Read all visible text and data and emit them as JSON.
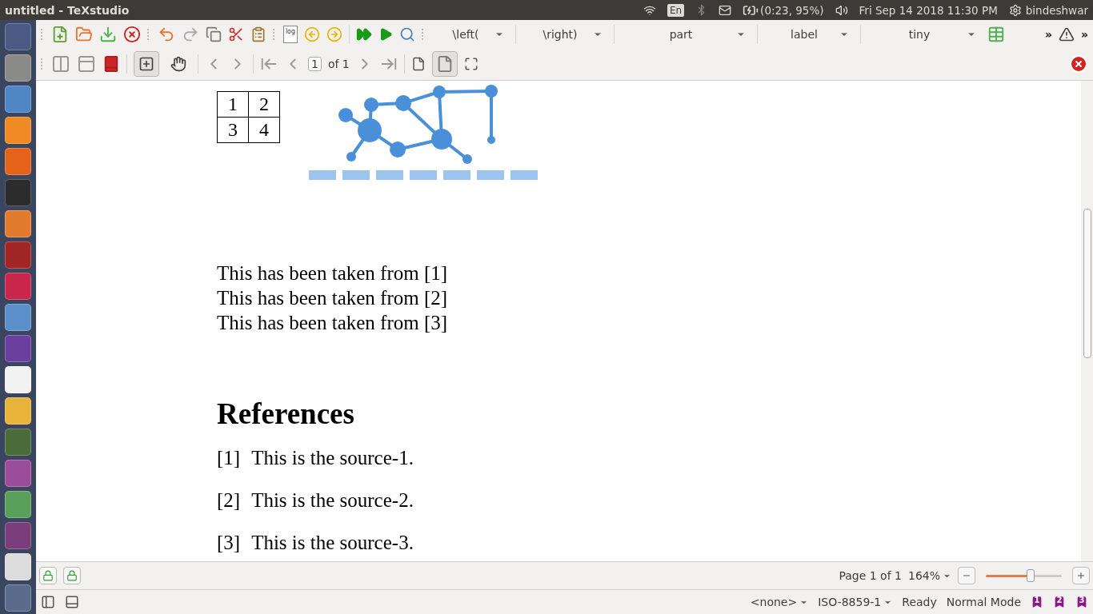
{
  "window": {
    "title": "untitled - TeXstudio"
  },
  "top_panel": {
    "keyboard": "En",
    "battery": "(0:23, 95%)",
    "clock": "Fri Sep 14 2018 11:30 PM",
    "user": "bindeshwar"
  },
  "toolbar": {
    "log_label": "log",
    "combos": [
      "\\left(",
      "\\right)",
      "part",
      "label",
      "tiny"
    ],
    "overflow": [
      "»",
      "»"
    ]
  },
  "viewer_toolbar": {
    "page_field": "1",
    "page_total": "of 1",
    "tools": [
      {
        "kind": "zoom-box",
        "selected": true
      },
      {
        "kind": "hand",
        "selected": false
      }
    ],
    "page_view_selected": true
  },
  "document": {
    "table": [
      [
        "1",
        "2"
      ],
      [
        "3",
        "4"
      ]
    ],
    "lines": [
      "This has been taken from [1]",
      "This has been taken from [2]",
      "This has been taken from [3]"
    ],
    "heading": "References",
    "references": [
      {
        "label": "[1]",
        "text": "This is the source-1."
      },
      {
        "label": "[2]",
        "text": "This is the source-2."
      },
      {
        "label": "[3]",
        "text": "This is the source-3."
      }
    ]
  },
  "viewer_bar": {
    "page": "Page 1 of 1",
    "zoom": "164%",
    "zoom_slider": {
      "level": 0.59
    }
  },
  "status_bar": {
    "encoding_mode": "<none>",
    "encoding": "ISO-8859-1",
    "status": "Ready",
    "mode": "Normal Mode",
    "bookmarks": [
      "1",
      "2",
      "3"
    ]
  }
}
